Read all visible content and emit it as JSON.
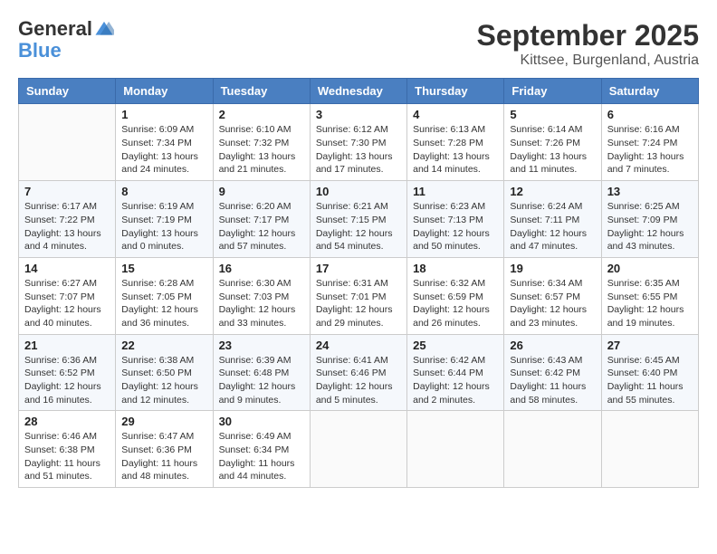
{
  "logo": {
    "general": "General",
    "blue": "Blue"
  },
  "header": {
    "month": "September 2025",
    "location": "Kittsee, Burgenland, Austria"
  },
  "weekdays": [
    "Sunday",
    "Monday",
    "Tuesday",
    "Wednesday",
    "Thursday",
    "Friday",
    "Saturday"
  ],
  "weeks": [
    [
      {
        "day": "",
        "sunrise": "",
        "sunset": "",
        "daylight": ""
      },
      {
        "day": "1",
        "sunrise": "6:09 AM",
        "sunset": "7:34 PM",
        "daylight": "13 hours and 24 minutes."
      },
      {
        "day": "2",
        "sunrise": "6:10 AM",
        "sunset": "7:32 PM",
        "daylight": "13 hours and 21 minutes."
      },
      {
        "day": "3",
        "sunrise": "6:12 AM",
        "sunset": "7:30 PM",
        "daylight": "13 hours and 17 minutes."
      },
      {
        "day": "4",
        "sunrise": "6:13 AM",
        "sunset": "7:28 PM",
        "daylight": "13 hours and 14 minutes."
      },
      {
        "day": "5",
        "sunrise": "6:14 AM",
        "sunset": "7:26 PM",
        "daylight": "13 hours and 11 minutes."
      },
      {
        "day": "6",
        "sunrise": "6:16 AM",
        "sunset": "7:24 PM",
        "daylight": "13 hours and 7 minutes."
      }
    ],
    [
      {
        "day": "7",
        "sunrise": "6:17 AM",
        "sunset": "7:22 PM",
        "daylight": "13 hours and 4 minutes."
      },
      {
        "day": "8",
        "sunrise": "6:19 AM",
        "sunset": "7:19 PM",
        "daylight": "13 hours and 0 minutes."
      },
      {
        "day": "9",
        "sunrise": "6:20 AM",
        "sunset": "7:17 PM",
        "daylight": "12 hours and 57 minutes."
      },
      {
        "day": "10",
        "sunrise": "6:21 AM",
        "sunset": "7:15 PM",
        "daylight": "12 hours and 54 minutes."
      },
      {
        "day": "11",
        "sunrise": "6:23 AM",
        "sunset": "7:13 PM",
        "daylight": "12 hours and 50 minutes."
      },
      {
        "day": "12",
        "sunrise": "6:24 AM",
        "sunset": "7:11 PM",
        "daylight": "12 hours and 47 minutes."
      },
      {
        "day": "13",
        "sunrise": "6:25 AM",
        "sunset": "7:09 PM",
        "daylight": "12 hours and 43 minutes."
      }
    ],
    [
      {
        "day": "14",
        "sunrise": "6:27 AM",
        "sunset": "7:07 PM",
        "daylight": "12 hours and 40 minutes."
      },
      {
        "day": "15",
        "sunrise": "6:28 AM",
        "sunset": "7:05 PM",
        "daylight": "12 hours and 36 minutes."
      },
      {
        "day": "16",
        "sunrise": "6:30 AM",
        "sunset": "7:03 PM",
        "daylight": "12 hours and 33 minutes."
      },
      {
        "day": "17",
        "sunrise": "6:31 AM",
        "sunset": "7:01 PM",
        "daylight": "12 hours and 29 minutes."
      },
      {
        "day": "18",
        "sunrise": "6:32 AM",
        "sunset": "6:59 PM",
        "daylight": "12 hours and 26 minutes."
      },
      {
        "day": "19",
        "sunrise": "6:34 AM",
        "sunset": "6:57 PM",
        "daylight": "12 hours and 23 minutes."
      },
      {
        "day": "20",
        "sunrise": "6:35 AM",
        "sunset": "6:55 PM",
        "daylight": "12 hours and 19 minutes."
      }
    ],
    [
      {
        "day": "21",
        "sunrise": "6:36 AM",
        "sunset": "6:52 PM",
        "daylight": "12 hours and 16 minutes."
      },
      {
        "day": "22",
        "sunrise": "6:38 AM",
        "sunset": "6:50 PM",
        "daylight": "12 hours and 12 minutes."
      },
      {
        "day": "23",
        "sunrise": "6:39 AM",
        "sunset": "6:48 PM",
        "daylight": "12 hours and 9 minutes."
      },
      {
        "day": "24",
        "sunrise": "6:41 AM",
        "sunset": "6:46 PM",
        "daylight": "12 hours and 5 minutes."
      },
      {
        "day": "25",
        "sunrise": "6:42 AM",
        "sunset": "6:44 PM",
        "daylight": "12 hours and 2 minutes."
      },
      {
        "day": "26",
        "sunrise": "6:43 AM",
        "sunset": "6:42 PM",
        "daylight": "11 hours and 58 minutes."
      },
      {
        "day": "27",
        "sunrise": "6:45 AM",
        "sunset": "6:40 PM",
        "daylight": "11 hours and 55 minutes."
      }
    ],
    [
      {
        "day": "28",
        "sunrise": "6:46 AM",
        "sunset": "6:38 PM",
        "daylight": "11 hours and 51 minutes."
      },
      {
        "day": "29",
        "sunrise": "6:47 AM",
        "sunset": "6:36 PM",
        "daylight": "11 hours and 48 minutes."
      },
      {
        "day": "30",
        "sunrise": "6:49 AM",
        "sunset": "6:34 PM",
        "daylight": "11 hours and 44 minutes."
      },
      {
        "day": "",
        "sunrise": "",
        "sunset": "",
        "daylight": ""
      },
      {
        "day": "",
        "sunrise": "",
        "sunset": "",
        "daylight": ""
      },
      {
        "day": "",
        "sunrise": "",
        "sunset": "",
        "daylight": ""
      },
      {
        "day": "",
        "sunrise": "",
        "sunset": "",
        "daylight": ""
      }
    ]
  ],
  "labels": {
    "sunrise": "Sunrise:",
    "sunset": "Sunset:",
    "daylight": "Daylight:"
  }
}
